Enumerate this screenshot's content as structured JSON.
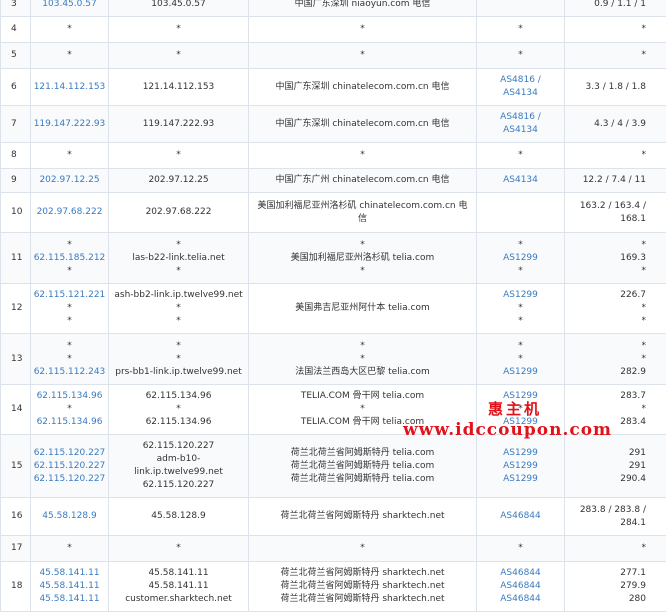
{
  "rows": [
    {
      "hop": "3",
      "ip": [
        "103.45.0.57"
      ],
      "host": [
        "103.45.0.57"
      ],
      "loc": [
        "中国广东深圳 niaoyun.com 电信"
      ],
      "asn": [
        ""
      ],
      "time": [
        "0.9 / 1.1 / 1"
      ],
      "h": 24
    },
    {
      "hop": "4",
      "ip": [
        "*"
      ],
      "host": [
        "*"
      ],
      "loc": [
        "*"
      ],
      "asn": [
        "*"
      ],
      "time": [
        "*"
      ],
      "h": 26
    },
    {
      "hop": "5",
      "ip": [
        "*"
      ],
      "host": [
        "*"
      ],
      "loc": [
        "*"
      ],
      "asn": [
        "*"
      ],
      "time": [
        "*"
      ],
      "h": 26
    },
    {
      "hop": "6",
      "ip": [
        "121.14.112.153"
      ],
      "host": [
        "121.14.112.153"
      ],
      "loc": [
        "中国广东深圳 chinatelecom.com.cn 电信"
      ],
      "asn": [
        "AS4816 /",
        "AS4134"
      ],
      "time": [
        "3.3 / 1.8 / 1.8"
      ],
      "h": 37
    },
    {
      "hop": "7",
      "ip": [
        "119.147.222.93"
      ],
      "host": [
        "119.147.222.93"
      ],
      "loc": [
        "中国广东深圳 chinatelecom.com.cn 电信"
      ],
      "asn": [
        "AS4816 /",
        "AS4134"
      ],
      "time": [
        "4.3 / 4 / 3.9"
      ],
      "h": 37
    },
    {
      "hop": "8",
      "ip": [
        "*"
      ],
      "host": [
        "*"
      ],
      "loc": [
        "*"
      ],
      "asn": [
        "*"
      ],
      "time": [
        "*"
      ],
      "h": 26
    },
    {
      "hop": "9",
      "ip": [
        "202.97.12.25"
      ],
      "host": [
        "202.97.12.25"
      ],
      "loc": [
        "中国广东广州 chinatelecom.com.cn 电信"
      ],
      "asn": [
        "AS4134"
      ],
      "time": [
        "12.2 / 7.4 / 11"
      ],
      "h": 24
    },
    {
      "hop": "10",
      "ip": [
        "202.97.68.222"
      ],
      "host": [
        "202.97.68.222"
      ],
      "loc": [
        "美国加利福尼亚州洛杉矶 chinatelecom.com.cn 电",
        "信"
      ],
      "asn": [
        ""
      ],
      "time": [
        "163.2 / 163.4 /",
        "168.1"
      ],
      "h": 40
    },
    {
      "hop": "11",
      "ip": [
        "*",
        "62.115.185.212",
        "*"
      ],
      "host": [
        "*",
        "las-b22-link.telia.net",
        "*"
      ],
      "loc": [
        "*",
        "美国加利福尼亚州洛杉矶 telia.com",
        "*"
      ],
      "asn": [
        "*",
        "AS1299",
        "*"
      ],
      "time": [
        "*",
        "169.3",
        "*"
      ],
      "h": 51
    },
    {
      "hop": "12",
      "ip": [
        "62.115.121.221",
        "*",
        "*"
      ],
      "host": [
        "ash-bb2-link.ip.twelve99.net",
        "*",
        "*"
      ],
      "loc": [
        "美国弗吉尼亚州阿什本 telia.com",
        "",
        ""
      ],
      "asn": [
        "AS1299",
        "*",
        "*"
      ],
      "time": [
        "226.7",
        "*",
        "*"
      ],
      "h": 50
    },
    {
      "hop": "13",
      "ip": [
        "*",
        "*",
        "62.115.112.243"
      ],
      "host": [
        "*",
        "*",
        "prs-bb1-link.ip.twelve99.net"
      ],
      "loc": [
        "*",
        "*",
        "法国法兰西岛大区巴黎 telia.com"
      ],
      "asn": [
        "*",
        "*",
        "AS1299"
      ],
      "time": [
        "*",
        "*",
        "282.9"
      ],
      "h": 51
    },
    {
      "hop": "14",
      "ip": [
        "62.115.134.96",
        "*",
        "62.115.134.96"
      ],
      "host": [
        "62.115.134.96",
        "*",
        "62.115.134.96"
      ],
      "loc": [
        "TELIA.COM 骨干网 telia.com",
        "*",
        "TELIA.COM 骨干网 telia.com"
      ],
      "asn": [
        "AS1299",
        "*",
        "AS1299"
      ],
      "time": [
        "283.7",
        "*",
        "283.4"
      ],
      "h": 50
    },
    {
      "hop": "15",
      "ip": [
        "62.115.120.227",
        "62.115.120.227",
        "62.115.120.227"
      ],
      "host": [
        "62.115.120.227",
        "adm-b10-",
        "link.ip.twelve99.net",
        "62.115.120.227"
      ],
      "loc": [
        "荷兰北荷兰省阿姆斯特丹 telia.com",
        "荷兰北荷兰省阿姆斯特丹 telia.com",
        "荷兰北荷兰省阿姆斯特丹 telia.com"
      ],
      "asn": [
        "AS1299",
        "AS1299",
        "AS1299"
      ],
      "time": [
        "291",
        "291",
        "290.4"
      ],
      "h": 63
    },
    {
      "hop": "16",
      "ip": [
        "45.58.128.9"
      ],
      "host": [
        "45.58.128.9"
      ],
      "loc": [
        "荷兰北荷兰省阿姆斯特丹 sharktech.net"
      ],
      "asn": [
        "AS46844"
      ],
      "time": [
        "283.8 / 283.8 /",
        "284.1"
      ],
      "h": 38
    },
    {
      "hop": "17",
      "ip": [
        "*"
      ],
      "host": [
        "*"
      ],
      "loc": [
        "*"
      ],
      "asn": [
        "*"
      ],
      "time": [
        "*"
      ],
      "h": 26
    },
    {
      "hop": "18",
      "ip": [
        "45.58.141.11",
        "45.58.141.11",
        "45.58.141.11"
      ],
      "host": [
        "45.58.141.11",
        "45.58.141.11",
        "customer.sharktech.net"
      ],
      "loc": [
        "荷兰北荷兰省阿姆斯特丹 sharktech.net",
        "荷兰北荷兰省阿姆斯特丹 sharktech.net",
        "荷兰北荷兰省阿姆斯特丹 sharktech.net"
      ],
      "asn": [
        "AS46844",
        "AS46844",
        "AS46844"
      ],
      "time": [
        "277.1",
        "279.9",
        "280"
      ],
      "h": 50
    }
  ],
  "watermark": {
    "cn": "惠主机",
    "url": "www.idccoupon.com",
    "color": "#e0121a"
  },
  "colors": {
    "link": "#3a7bbf",
    "border": "#dde3ea",
    "text": "#333333"
  }
}
